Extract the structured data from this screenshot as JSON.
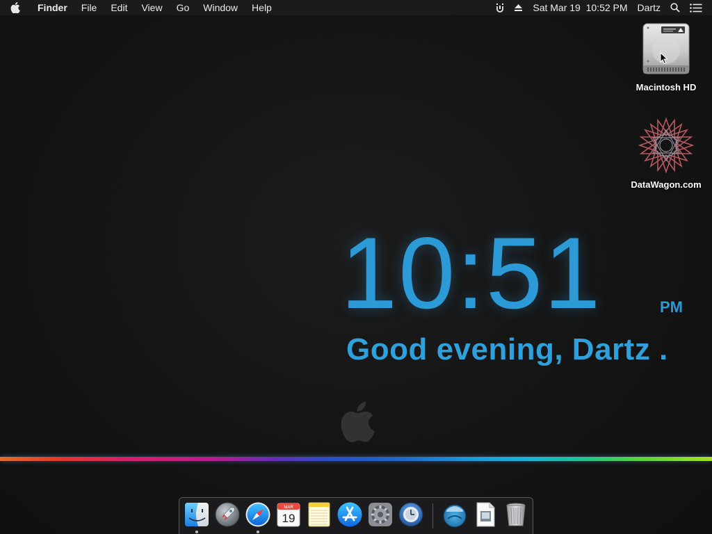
{
  "menubar": {
    "apple_icon": "apple-logo-icon",
    "app_name": "Finder",
    "menus": [
      "File",
      "Edit",
      "View",
      "Go",
      "Window",
      "Help"
    ],
    "status": {
      "datetime": "Sat Mar 19  10:52 PM",
      "user": "Dartz",
      "icons": [
        "touch-extension-icon",
        "eject-icon",
        "spotlight-search-icon",
        "notification-center-icon"
      ]
    }
  },
  "desktop_icons": [
    {
      "label": "Macintosh HD",
      "icon": "hard-drive-icon"
    },
    {
      "label": "DataWagon.com",
      "icon": "star-mandala-icon"
    }
  ],
  "clock": {
    "time": "10:51",
    "ampm": "PM",
    "greeting": "Good evening, Dartz ."
  },
  "dock": {
    "items": [
      {
        "name": "Finder",
        "icon": "finder-icon",
        "running": true
      },
      {
        "name": "Launchpad",
        "icon": "launchpad-icon",
        "running": false
      },
      {
        "name": "Safari",
        "icon": "safari-icon",
        "running": true
      },
      {
        "name": "Calendar",
        "icon": "calendar-icon",
        "running": false,
        "month": "MAR",
        "day": "19"
      },
      {
        "name": "Notes",
        "icon": "notes-icon",
        "running": false
      },
      {
        "name": "App Store",
        "icon": "app-store-icon",
        "running": false
      },
      {
        "name": "System Preferences",
        "icon": "system-preferences-icon",
        "running": false
      },
      {
        "name": "Time Machine",
        "icon": "time-machine-icon",
        "running": false
      },
      {
        "name": "Downloads",
        "icon": "downloads-folder-icon",
        "running": false
      },
      {
        "name": "Preview",
        "icon": "preview-document-icon",
        "running": false
      },
      {
        "name": "Trash",
        "icon": "trash-icon",
        "running": false
      }
    ]
  },
  "colors": {
    "clock_blue": "#2b9ad6",
    "menubar_bg": "#1b1b1b",
    "desktop_bg": "#141414"
  }
}
